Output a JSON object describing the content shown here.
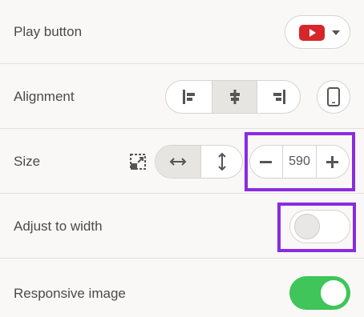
{
  "rows": {
    "play_button": {
      "label": "Play button",
      "selected_icon": "youtube-logo-icon"
    },
    "alignment": {
      "label": "Alignment",
      "options": [
        "align-left-icon",
        "align-center-icon",
        "align-right-icon"
      ],
      "active": "align-center-icon",
      "mobile_icon": "mobile-phone-icon"
    },
    "size": {
      "label": "Size",
      "value": "590",
      "modes": [
        "stretch-horizontal-icon",
        "stretch-vertical-icon"
      ],
      "active_mode": "stretch-horizontal-icon"
    },
    "adjust_width": {
      "label": "Adjust to width",
      "enabled": false
    },
    "responsive": {
      "label": "Responsive image",
      "enabled": true
    }
  },
  "colors": {
    "accent_highlight": "#8a2be2",
    "toggle_on": "#3fc55a",
    "youtube_red": "#d7262a"
  }
}
